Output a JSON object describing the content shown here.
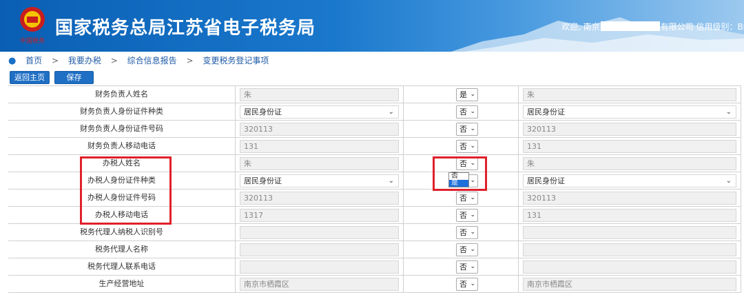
{
  "header": {
    "title": "国家税务总局江苏省电子税务局",
    "welcome_prefix": "欢迎, 南京",
    "welcome_suffix": "有限公司  信用级别：B级  |  ",
    "emblem_text": "中国税务"
  },
  "breadcrumb": [
    "首页",
    "我要办税",
    "综合信息报告",
    "变更税务登记事项"
  ],
  "toolbar": {
    "home_label": "返回主页",
    "save_label": "保存"
  },
  "rows": [
    {
      "label": "财务负责人姓名",
      "old": "朱",
      "flag": "是",
      "new": "朱",
      "type": "text"
    },
    {
      "label": "财务负责人身份证件种类",
      "old": "居民身份证",
      "flag": "否",
      "new": "居民身份证",
      "type": "select"
    },
    {
      "label": "财务负责人身份证件号码",
      "old": "320113",
      "flag": "否",
      "new": "320113",
      "type": "text"
    },
    {
      "label": "财务负责人移动电话",
      "old": "131",
      "flag": "否",
      "new": "131",
      "type": "text"
    },
    {
      "label": "办税人姓名",
      "old": "朱",
      "flag": "否",
      "new": "朱",
      "type": "text"
    },
    {
      "label": "办税人身份证件种类",
      "old": "居民身份证",
      "flag": "否",
      "new": "居民身份证",
      "type": "select"
    },
    {
      "label": "办税人身份证件号码",
      "old": "320113",
      "flag": "否",
      "new": "320113",
      "type": "text"
    },
    {
      "label": "办税人移动电话",
      "old": "1317",
      "flag": "否",
      "new": "131",
      "type": "text"
    },
    {
      "label": "税务代理人纳税人识别号",
      "old": "",
      "flag": "否",
      "new": "",
      "type": "text"
    },
    {
      "label": "税务代理人名称",
      "old": "",
      "flag": "否",
      "new": "",
      "type": "text"
    },
    {
      "label": "税务代理人联系电话",
      "old": "",
      "flag": "否",
      "new": "",
      "type": "text"
    },
    {
      "label": "生产经营地址",
      "old": "南京市栖霞区",
      "flag": "否",
      "new": "南京市栖霞区",
      "type": "text"
    }
  ],
  "dropdown_options": [
    "否",
    "是"
  ],
  "dropdown_selected": "是",
  "colors": {
    "header_blue": "#0a5fb4",
    "button_blue": "#1f6fc4",
    "highlight_red": "#e0202a"
  }
}
